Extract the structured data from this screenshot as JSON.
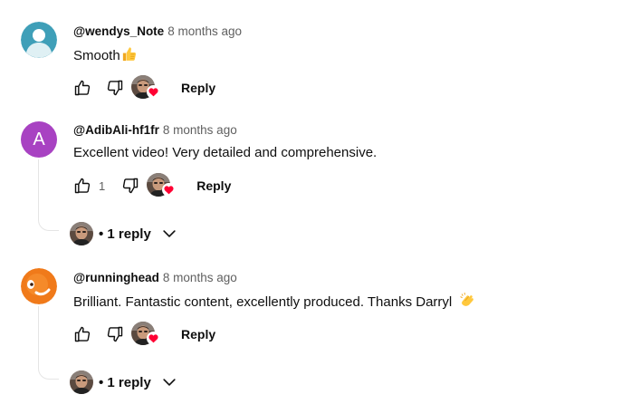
{
  "comments": [
    {
      "author": "@wendys_Note",
      "time": "8 months ago",
      "text": "Smooth",
      "emoji": "thumbs-up",
      "like_count": "",
      "reply_label": "Reply",
      "avatar": "default-person-avatar",
      "avatar_color": "#3f9fb8"
    },
    {
      "author": "@AdibAli-hf1fr",
      "time": "8 months ago",
      "text": "Excellent video! Very detailed and comprehensive.",
      "like_count": "1",
      "reply_label": "Reply",
      "avatar_letter": "A",
      "avatar_color": "#a842c2",
      "replies_label": "1 reply"
    },
    {
      "author": "@runninghead",
      "time": "8 months ago",
      "text": "Brilliant. Fantastic content, excellently produced. Thanks Darryl",
      "emoji": "clapping-hands",
      "like_count": "",
      "reply_label": "Reply",
      "avatar": "orange-smiley-avatar",
      "avatar_color": "#f07a1a",
      "replies_label": "1 reply"
    }
  ],
  "colors": {
    "heart": "#ff0033",
    "secondary_text": "#606060",
    "thread_line": "#e5e5e5"
  }
}
